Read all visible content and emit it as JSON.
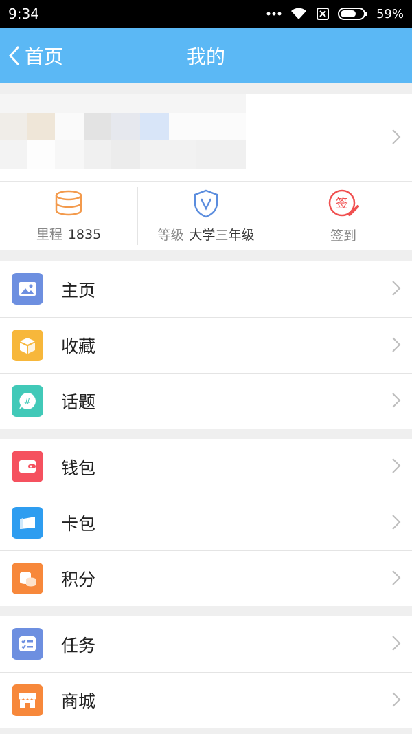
{
  "status_bar": {
    "time": "9:34",
    "battery": "59%",
    "icons": [
      "more-dots-icon",
      "wifi-icon",
      "no-sim-icon",
      "battery-icon"
    ]
  },
  "nav": {
    "back_label": "首页",
    "title": "我的"
  },
  "stats": [
    {
      "label": "里程",
      "value": "1835",
      "icon": "coin-stack-icon",
      "color": "#f39a4c"
    },
    {
      "label": "等级",
      "value": "大学三年级",
      "icon": "shield-v-icon",
      "color": "#5b8dde"
    },
    {
      "label": "签到",
      "value": "",
      "icon": "sign-in-stamp-icon",
      "color": "#f05050"
    }
  ],
  "menu_groups": [
    [
      {
        "label": "主页",
        "icon": "image-icon",
        "color": "#6d8fe0"
      },
      {
        "label": "收藏",
        "icon": "box-icon",
        "color": "#f7b73b"
      },
      {
        "label": "话题",
        "icon": "topic-bubble-icon",
        "color": "#41c9b8"
      }
    ],
    [
      {
        "label": "钱包",
        "icon": "wallet-icon",
        "color": "#f5515f"
      },
      {
        "label": "卡包",
        "icon": "card-pack-icon",
        "color": "#2e9df0"
      },
      {
        "label": "积分",
        "icon": "points-coins-icon",
        "color": "#f7883b"
      }
    ],
    [
      {
        "label": "任务",
        "icon": "task-list-icon",
        "color": "#6d8fe0"
      },
      {
        "label": "商城",
        "icon": "shop-icon",
        "color": "#f7883b"
      }
    ]
  ],
  "colors": {
    "nav_bg": "#5bb8f5",
    "page_bg": "#efefef"
  }
}
